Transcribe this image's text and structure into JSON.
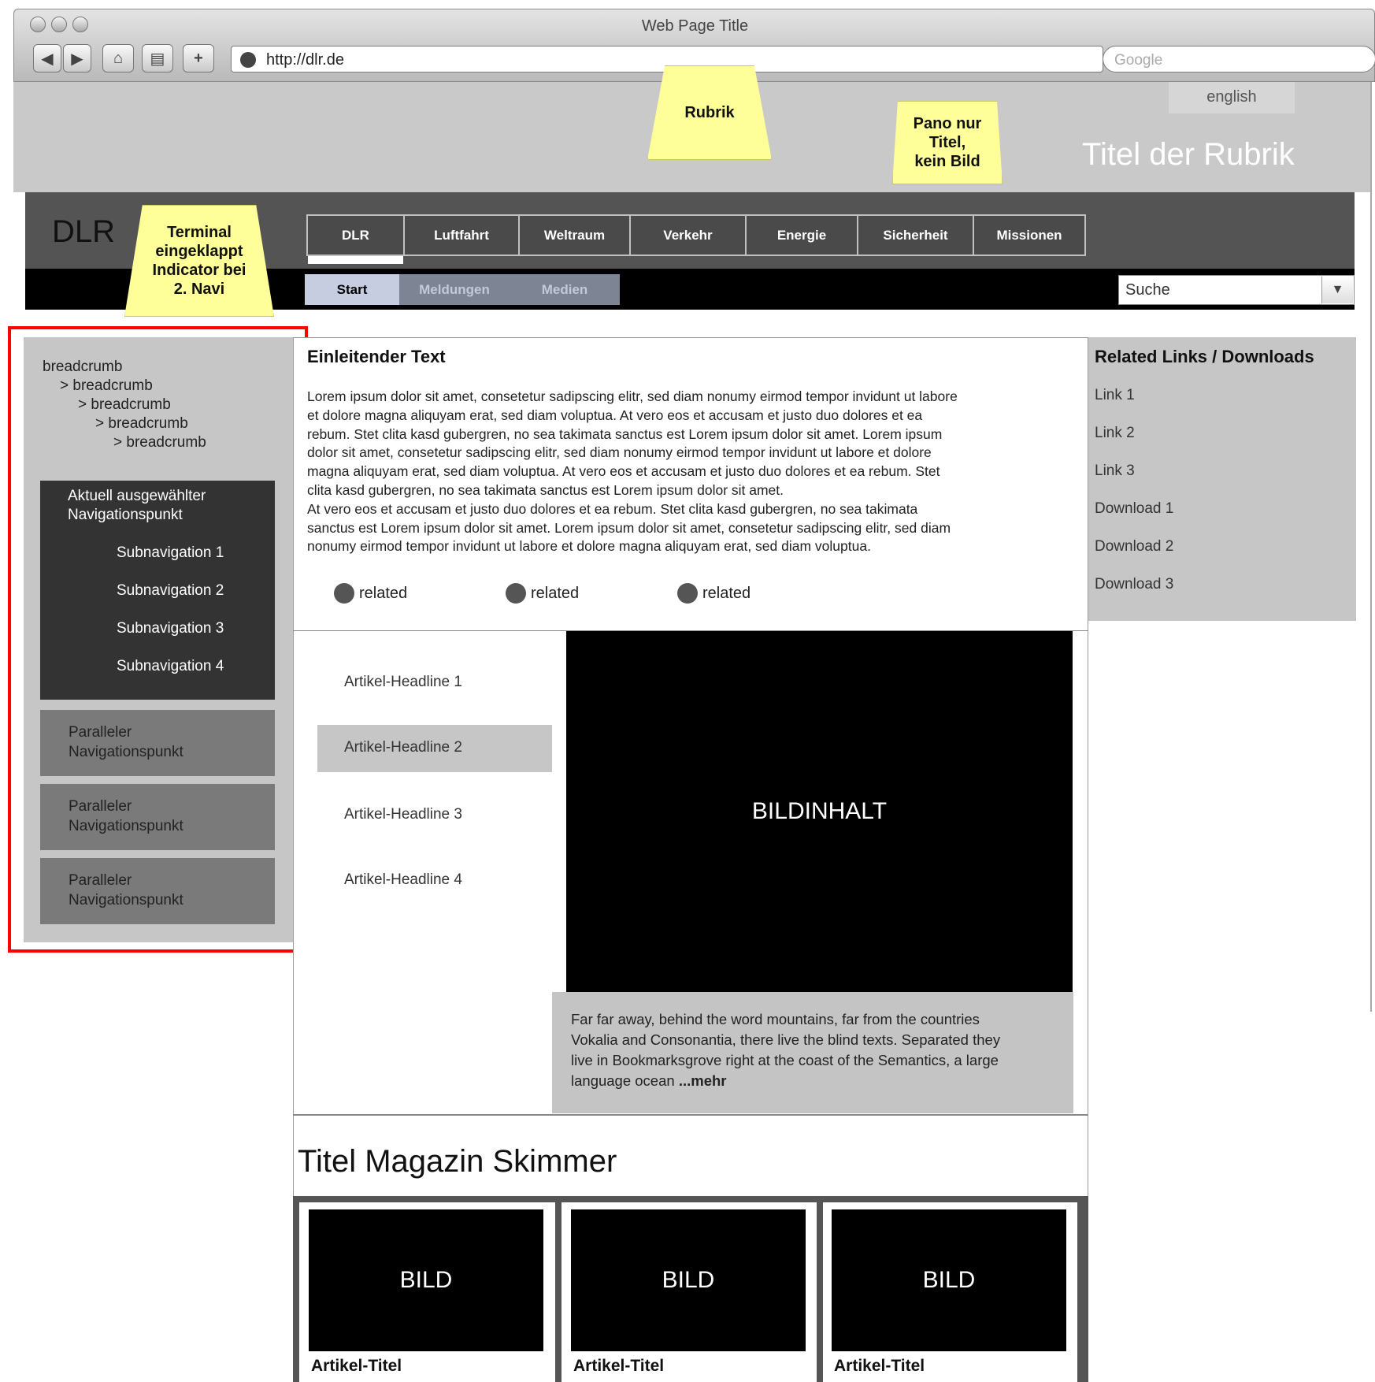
{
  "browser": {
    "window_title": "Web Page Title",
    "url": "http://dlr.de",
    "search_placeholder": "Google"
  },
  "header": {
    "language_button": "english",
    "rubric_title": "Titel der Rubrik"
  },
  "notes": {
    "rubrik": "Rubrik",
    "pano": [
      "Pano nur",
      "Titel,",
      "kein Bild"
    ],
    "terminal": [
      "Terminal",
      "eingeklappt",
      "Indicator bei",
      "2. Navi"
    ]
  },
  "site": {
    "logo": "DLR",
    "main_tabs": [
      "DLR",
      "Luftfahrt",
      "Weltraum",
      "Verkehr",
      "Energie",
      "Sicherheit",
      "Missionen"
    ],
    "sub_tabs": [
      "Start",
      "Meldungen",
      "Medien"
    ],
    "search_value": "Suche"
  },
  "leftnav": {
    "breadcrumbs": [
      "breadcrumb",
      "> breadcrumb",
      "> breadcrumb",
      "> breadcrumb",
      "> breadcrumb"
    ],
    "active_item": [
      "Aktuell ausgewählter",
      "Navigationspunkt"
    ],
    "subnav": [
      "Subnavigation 1",
      "Subnavigation 2",
      "Subnavigation 3",
      "Subnavigation 4"
    ],
    "parallel": [
      [
        "Paralleler",
        "Navigationspunkt"
      ],
      [
        "Paralleler",
        "Navigationspunkt"
      ],
      [
        "Paralleler",
        "Navigationspunkt"
      ]
    ]
  },
  "content": {
    "intro_heading": "Einleitender Text",
    "intro_lines": [
      "Lorem ipsum dolor sit amet, consetetur sadipscing elitr, sed diam nonumy eirmod tempor invidunt ut labore",
      "et dolore magna aliquyam erat, sed diam voluptua. At vero eos et accusam et justo duo dolores et ea",
      "rebum. Stet clita kasd gubergren, no sea takimata sanctus est Lorem ipsum dolor sit amet. Lorem ipsum",
      "dolor sit amet, consetetur sadipscing elitr, sed diam nonumy eirmod tempor invidunt ut labore et dolore",
      "magna aliquyam erat, sed diam voluptua. At vero eos et accusam et justo duo dolores et ea rebum. Stet",
      "clita kasd gubergren, no sea takimata sanctus est Lorem ipsum dolor sit amet.",
      "At vero eos et accusam et justo duo dolores et ea rebum. Stet clita kasd gubergren, no sea takimata",
      "sanctus est Lorem ipsum dolor sit amet. Lorem ipsum dolor sit amet, consetetur sadipscing elitr, sed diam",
      "nonumy eirmod tempor invidunt ut labore et dolore magna aliquyam erat, sed diam voluptua."
    ],
    "related": [
      "related",
      "related",
      "related"
    ],
    "article_headlines": [
      "Artikel-Headline 1",
      "Artikel-Headline 2",
      "Artikel-Headline 3",
      "Artikel-Headline 4"
    ],
    "image_label": "BILDINHALT",
    "caption_lines": [
      "Far far away, behind the word mountains, far from the countries",
      "Vokalia and Consonantia, there live the blind texts. Separated they",
      "live in Bookmarksgrove right at the coast of the Semantics, a large",
      "language ocean "
    ],
    "caption_more": "...mehr",
    "skimmer_title": "Titel Magazin Skimmer",
    "skimmer_cards": [
      {
        "image": "BILD",
        "title": "Artikel-Titel"
      },
      {
        "image": "BILD",
        "title": "Artikel-Titel"
      },
      {
        "image": "BILD",
        "title": "Artikel-Titel"
      }
    ]
  },
  "right": {
    "heading": "Related Links / Downloads",
    "links": [
      "Link 1",
      "Link 2",
      "Link 3",
      "Download 1",
      "Download 2",
      "Download 3"
    ]
  },
  "colors": {
    "note_yellow": "#ffff99",
    "highlight_red": "#ff0000",
    "nav_dark": "#545454"
  }
}
